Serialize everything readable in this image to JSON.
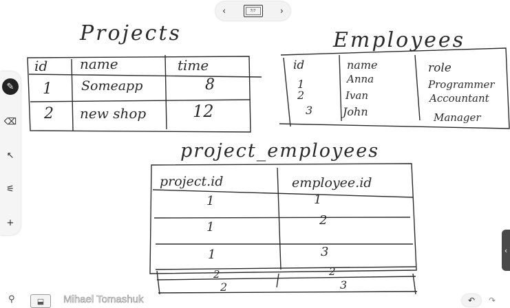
{
  "nav": {
    "prev": "‹",
    "page": "7/7",
    "next": "›"
  },
  "toolbar": {
    "tools": [
      {
        "name": "pen-tool",
        "glyph": "✎"
      },
      {
        "name": "eraser-tool",
        "glyph": "⌫"
      },
      {
        "name": "pointer-tool",
        "glyph": "↖"
      },
      {
        "name": "highlighter-tool",
        "glyph": "⚟"
      },
      {
        "name": "add-tool",
        "glyph": "+"
      }
    ]
  },
  "board": {
    "projects": {
      "title": "Projects",
      "headers": [
        "id",
        "name",
        "time"
      ],
      "rows": [
        [
          "1",
          "Someapp",
          "8"
        ],
        [
          "2",
          "new shop",
          "12"
        ]
      ]
    },
    "employees": {
      "title": "Employees",
      "headers": [
        "id",
        "name",
        "role"
      ],
      "rows": [
        [
          "1",
          "Anna",
          "Programmer"
        ],
        [
          "2",
          "Ivan",
          "Accountant"
        ],
        [
          "3",
          "John",
          "Manager"
        ]
      ]
    },
    "project_employees": {
      "title": "project_employees",
      "headers": [
        "project.id",
        "employee.id"
      ],
      "rows": [
        [
          "1",
          "1"
        ],
        [
          "1",
          "2"
        ],
        [
          "1",
          "3"
        ],
        [
          "2",
          "2"
        ],
        [
          "2",
          "3"
        ]
      ]
    }
  },
  "footer": {
    "presenter": "Mihael Tomashuk",
    "pin_icon": "pin-icon",
    "screen_icon": "screen-share-icon",
    "undo": "↶",
    "redo": "↷"
  },
  "sidetab": {
    "glyph": "‹"
  }
}
